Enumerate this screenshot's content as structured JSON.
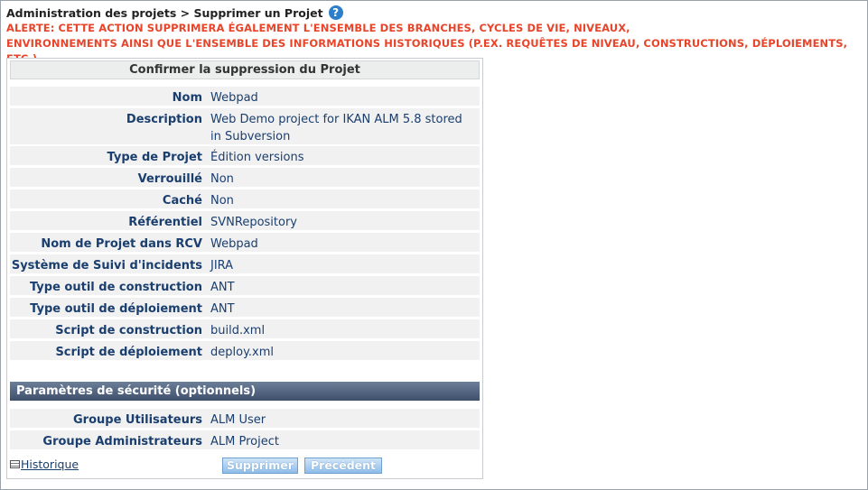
{
  "breadcrumb": {
    "text": "Administration des projets > Supprimer un Projet",
    "help_icon": "?"
  },
  "alert": {
    "line1": "ALERTE: CETTE ACTION SUPPRIMERA ÉGALEMENT L'ENSEMBLE DES BRANCHES, CYCLES DE VIE, NIVEAUX,",
    "line2": "ENVIRONNEMENTS AINSI QUE L'ENSEMBLE DES INFORMATIONS HISTORIQUES (P.EX. REQUÊTES DE NIVEAU, CONSTRUCTIONS, DÉPLOIEMENTS, ETC.)"
  },
  "panel": {
    "title": "Confirmer la suppression du Projet",
    "fields": [
      {
        "label": "Nom",
        "value": "Webpad"
      },
      {
        "label": "Description",
        "value": "Web Demo project for IKAN ALM 5.8 stored in Subversion"
      },
      {
        "label": "Type de Projet",
        "value": "Édition versions"
      },
      {
        "label": "Verrouillé",
        "value": "Non"
      },
      {
        "label": "Caché",
        "value": "Non"
      },
      {
        "label": "Référentiel",
        "value": "SVNRepository"
      },
      {
        "label": "Nom de Projet dans RCV",
        "value": "Webpad"
      },
      {
        "label": "Système de Suivi d'incidents",
        "value": "JIRA"
      },
      {
        "label": "Type outil de construction",
        "value": "ANT"
      },
      {
        "label": "Type outil de déploiement",
        "value": "ANT"
      },
      {
        "label": "Script de construction",
        "value": "build.xml"
      },
      {
        "label": "Script de déploiement",
        "value": "deploy.xml"
      }
    ],
    "security": {
      "title": "Paramètres de sécurité (optionnels)",
      "fields": [
        {
          "label": "Groupe Utilisateurs",
          "value": "ALM User"
        },
        {
          "label": "Groupe Administrateurs",
          "value": "ALM Project"
        }
      ]
    },
    "historique_label": "Historique",
    "delete_label": "Supprimer",
    "previous_label": "Précédent"
  },
  "colors": {
    "alert": "#e8442a",
    "label": "#1a3e6e",
    "section_header": "#4a5b76",
    "button": "#a9cdf0"
  }
}
